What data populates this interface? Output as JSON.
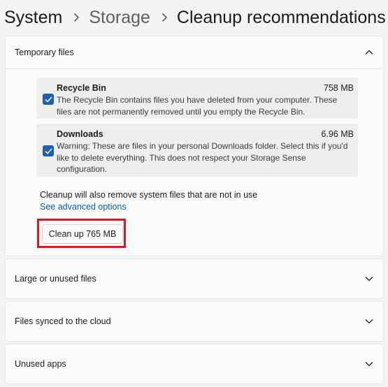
{
  "breadcrumb": {
    "root": "System",
    "middle": "Storage",
    "current": "Cleanup recommendations"
  },
  "sections": {
    "temporary": {
      "title": "Temporary files",
      "expanded": true,
      "items": [
        {
          "title": "Recycle Bin",
          "size": "758 MB",
          "checked": true,
          "description": "The Recycle Bin contains files you have deleted from your computer. These files are not permanently removed until you empty the Recycle Bin."
        },
        {
          "title": "Downloads",
          "size": "6.96 MB",
          "checked": true,
          "description": "Warning: These are files in your personal Downloads folder. Select this if you'd like to delete everything. This does not respect your Storage Sense configuration."
        }
      ],
      "note": "Cleanup will also remove system files that are not in use",
      "advanced_link": "See advanced options",
      "cleanup_button": "Clean up 765 MB"
    },
    "large": {
      "title": "Large or unused files",
      "expanded": false
    },
    "synced": {
      "title": "Files synced to the cloud",
      "expanded": false
    },
    "apps": {
      "title": "Unused apps",
      "expanded": false
    }
  },
  "icons": {
    "breadcrumb_separator": "chevron-right-icon",
    "collapse": "chevron-up-icon",
    "expand": "chevron-down-icon",
    "checkbox": "checkmark-icon"
  },
  "colors": {
    "accent": "#1c5fb8",
    "link": "#0b5cad",
    "highlight": "#e3141f",
    "background": "#f3f3f3",
    "card": "#fbfbfb"
  }
}
